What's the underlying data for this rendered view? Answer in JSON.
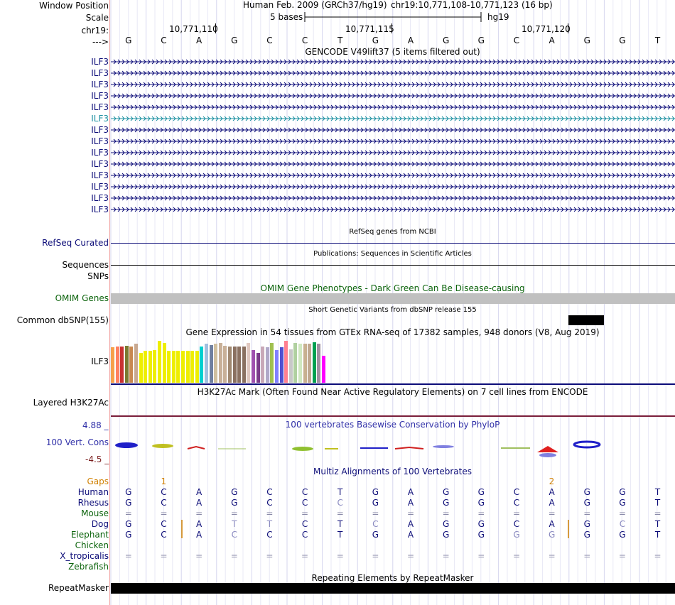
{
  "header": {
    "window_position_label": "Window Position",
    "assembly": "Human Feb. 2009 (GRCh37/hg19)",
    "position": "chr19:10,771,108-10,771,123 (16 bp)",
    "scale_label": "Scale",
    "scale_text": "5 bases",
    "scale_db": "hg19",
    "chrom_label": "chr19:",
    "ticks": [
      "10,771,110",
      "10,771,115",
      "10,771,120"
    ],
    "strand_label": "--->"
  },
  "sequence": [
    "G",
    "C",
    "A",
    "G",
    "C",
    "C",
    "T",
    "G",
    "A",
    "G",
    "G",
    "C",
    "A",
    "G",
    "G",
    "T"
  ],
  "gencode": {
    "title": "GENCODE V49lift37 (5 items filtered out)",
    "items": [
      "ILF3",
      "ILF3",
      "ILF3",
      "ILF3",
      "ILF3",
      "ILF3",
      "ILF3",
      "ILF3",
      "ILF3",
      "ILF3",
      "ILF3",
      "ILF3",
      "ILF3",
      "ILF3"
    ],
    "highlight_index": 5,
    "color": "#0c0c78",
    "highlight_color": "#1a8fa0"
  },
  "refseq": {
    "title": "RefSeq genes from NCBI",
    "label": "RefSeq Curated"
  },
  "publications": {
    "title": "Publications: Sequences in Scientific Articles",
    "label1": "Sequences",
    "label2": "SNPs"
  },
  "omim": {
    "title": "OMIM Gene Phenotypes - Dark Green Can Be Disease-causing",
    "label": "OMIM Genes"
  },
  "dbsnp": {
    "title": "Short Genetic Variants from dbSNP release 155",
    "label": "Common dbSNP(155)"
  },
  "gtex": {
    "title": "Gene Expression in 54 tissues from GTEx RNA-seq of 17382 samples, 948 donors (V8, Aug 2019)",
    "label": "ILF3",
    "bars": [
      {
        "h": 0.8,
        "c": "#f6a04a"
      },
      {
        "h": 0.82,
        "c": "#ff8060"
      },
      {
        "h": 0.82,
        "c": "#c83232"
      },
      {
        "h": 0.84,
        "c": "#7a7a30"
      },
      {
        "h": 0.82,
        "c": "#c88850"
      },
      {
        "h": 0.88,
        "c": "#c8a890"
      },
      {
        "h": 0.68,
        "c": "#eeee00"
      },
      {
        "h": 0.72,
        "c": "#eeee00"
      },
      {
        "h": 0.72,
        "c": "#eeee00"
      },
      {
        "h": 0.74,
        "c": "#eeee00"
      },
      {
        "h": 0.95,
        "c": "#eeee00"
      },
      {
        "h": 0.9,
        "c": "#eeee00"
      },
      {
        "h": 0.72,
        "c": "#eeee00"
      },
      {
        "h": 0.72,
        "c": "#eeee00"
      },
      {
        "h": 0.72,
        "c": "#eeee00"
      },
      {
        "h": 0.72,
        "c": "#eeee00"
      },
      {
        "h": 0.72,
        "c": "#eeee00"
      },
      {
        "h": 0.72,
        "c": "#eeee00"
      },
      {
        "h": 0.72,
        "c": "#eeee00"
      },
      {
        "h": 0.82,
        "c": "#00d0d0"
      },
      {
        "h": 0.88,
        "c": "#a0c0e0"
      },
      {
        "h": 0.86,
        "c": "#7080a0"
      },
      {
        "h": 0.88,
        "c": "#d0c0a0"
      },
      {
        "h": 0.9,
        "c": "#c8b098"
      },
      {
        "h": 0.84,
        "c": "#c8b098"
      },
      {
        "h": 0.82,
        "c": "#a08870"
      },
      {
        "h": 0.82,
        "c": "#8a7060"
      },
      {
        "h": 0.82,
        "c": "#8a7060"
      },
      {
        "h": 0.82,
        "c": "#8a7060"
      },
      {
        "h": 0.9,
        "c": "#e0c8c0"
      },
      {
        "h": 0.74,
        "c": "#a050b0"
      },
      {
        "h": 0.68,
        "c": "#7a3a8a"
      },
      {
        "h": 0.82,
        "c": "#c8a8b8"
      },
      {
        "h": 0.8,
        "c": "#b0a8c8"
      },
      {
        "h": 0.9,
        "c": "#a0c050"
      },
      {
        "h": 0.74,
        "c": "#8080ff"
      },
      {
        "h": 0.8,
        "c": "#5050d0"
      },
      {
        "h": 0.95,
        "c": "#ff8090"
      },
      {
        "h": 0.76,
        "c": "#c8c8c8"
      },
      {
        "h": 0.9,
        "c": "#b0d0a0"
      },
      {
        "h": 0.88,
        "c": "#d0e8c0"
      },
      {
        "h": 0.88,
        "c": "#c8b090"
      },
      {
        "h": 0.88,
        "c": "#c0a890"
      },
      {
        "h": 0.92,
        "c": "#00a050"
      },
      {
        "h": 0.88,
        "c": "#a090a0"
      },
      {
        "h": 0.62,
        "c": "#ff00ff"
      }
    ]
  },
  "h3k27ac": {
    "title": "H3K27Ac Mark (Often Found Near Active Regulatory Elements) on 7 cell lines from ENCODE",
    "label": "Layered H3K27Ac"
  },
  "phylop": {
    "title": "100 vertebrates Basewise Conservation by PhyloP",
    "label": "100 Vert. Cons",
    "max": "4.88 _",
    "min": "-4.5 _"
  },
  "multiz": {
    "title": "Multiz Alignments of 100 Vertebrates",
    "gaps_label": "Gaps",
    "gap_marks": [
      {
        "col": 1.5,
        "text": "1"
      },
      {
        "col": 12.5,
        "text": "2"
      }
    ],
    "species": [
      {
        "name": "Human",
        "color": "#0c0c78",
        "seq": [
          "G",
          "C",
          "A",
          "G",
          "C",
          "C",
          "T",
          "G",
          "A",
          "G",
          "G",
          "C",
          "A",
          "G",
          "G",
          "T"
        ]
      },
      {
        "name": "Rhesus",
        "color": "#0c0c78",
        "seq": [
          "G",
          "C",
          "A",
          "G",
          "C",
          "C",
          "C",
          "G",
          "A",
          "G",
          "G",
          "C",
          "A",
          "G",
          "G",
          "T"
        ]
      },
      {
        "name": "Mouse",
        "color": "#0c640c",
        "seq": [
          "=",
          "=",
          "=",
          "=",
          "=",
          "=",
          "=",
          "=",
          "=",
          "=",
          "=",
          "=",
          "=",
          "=",
          "=",
          "="
        ]
      },
      {
        "name": "Dog",
        "color": "#0c0c78",
        "seq": [
          "G",
          "C",
          "A",
          "T",
          "T",
          "C",
          "T",
          "C",
          "A",
          "G",
          "G",
          "C",
          "A",
          "G",
          "C",
          "T"
        ]
      },
      {
        "name": "Elephant",
        "color": "#0c640c",
        "seq": [
          "G",
          "C",
          "A",
          "C",
          "C",
          "C",
          "T",
          "G",
          "A",
          "G",
          "G",
          "G",
          "G",
          "G",
          "G",
          "T"
        ]
      },
      {
        "name": "Chicken",
        "color": "#0c640c",
        "seq": []
      },
      {
        "name": "X_tropicalis",
        "color": "#0c0c78",
        "seq": [
          "=",
          "=",
          "=",
          "=",
          "=",
          "=",
          "=",
          "=",
          "=",
          "=",
          "=",
          "=",
          "=",
          "=",
          "=",
          "="
        ]
      },
      {
        "name": "Zebrafish",
        "color": "#0c640c",
        "seq": []
      }
    ]
  },
  "repeatmasker": {
    "title": "Repeating Elements by RepeatMasker",
    "label": "RepeatMasker"
  }
}
